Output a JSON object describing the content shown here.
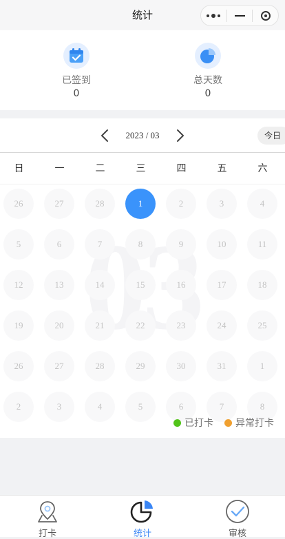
{
  "navbar": {
    "title": "统计",
    "more_icon": "more-dots-icon",
    "minimize_icon": "minimize-icon",
    "close_icon": "target-close-icon"
  },
  "stats": {
    "signed": {
      "label": "已签到",
      "value": "0",
      "icon": "calendar-check-icon"
    },
    "total_days": {
      "label": "总天数",
      "value": "0",
      "icon": "pie-chart-icon"
    }
  },
  "calendar": {
    "month_label": "2023 / 03",
    "watermark": "03",
    "today_label": "今日",
    "weekdays": [
      "日",
      "一",
      "二",
      "三",
      "四",
      "五",
      "六"
    ],
    "weeks": [
      [
        "26",
        "27",
        "28",
        "1",
        "2",
        "3",
        "4"
      ],
      [
        "5",
        "6",
        "7",
        "8",
        "9",
        "10",
        "11"
      ],
      [
        "12",
        "13",
        "14",
        "15",
        "16",
        "17",
        "18"
      ],
      [
        "19",
        "20",
        "21",
        "22",
        "23",
        "24",
        "25"
      ],
      [
        "26",
        "27",
        "28",
        "29",
        "30",
        "31",
        "1"
      ],
      [
        "2",
        "3",
        "4",
        "5",
        "6",
        "7",
        "8"
      ]
    ],
    "selected_day": "1",
    "accent_color": "#3a93fb"
  },
  "legend": {
    "checked_in": {
      "label": "已打卡",
      "color": "#52c41a"
    },
    "abnormal": {
      "label": "异常打卡",
      "color": "#f0a030"
    }
  },
  "tabbar": {
    "items": [
      {
        "label": "打卡",
        "icon": "location-pin-icon",
        "active": false
      },
      {
        "label": "统计",
        "icon": "pie-chart-icon",
        "active": true
      },
      {
        "label": "审核",
        "icon": "check-circle-icon",
        "active": false
      }
    ],
    "active_color": "#3a86f5"
  }
}
